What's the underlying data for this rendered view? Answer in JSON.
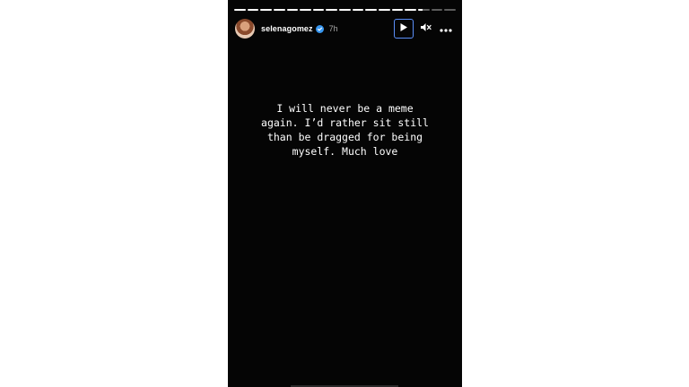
{
  "story": {
    "progress": [
      1,
      1,
      1,
      1,
      1,
      1,
      1,
      1,
      1,
      1,
      1,
      1,
      1,
      1,
      0.4,
      0,
      0
    ],
    "user": {
      "username": "selenagomez",
      "verified": true,
      "time": "7h"
    },
    "controls": {
      "play_icon": "play-icon",
      "mute_icon": "volume-muted-icon",
      "more_icon": "more-options-icon"
    },
    "caption": "I will never be a meme\nagain. I’d rather sit still\nthan be dragged for being\nmyself. Much love"
  },
  "colors": {
    "background": "#ffffff",
    "story_background": "#050505",
    "text": "#ffffff",
    "muted_text": "#a8a8a8",
    "verified_badge": "#3897f0",
    "focus_ring": "#5b8ff9"
  }
}
